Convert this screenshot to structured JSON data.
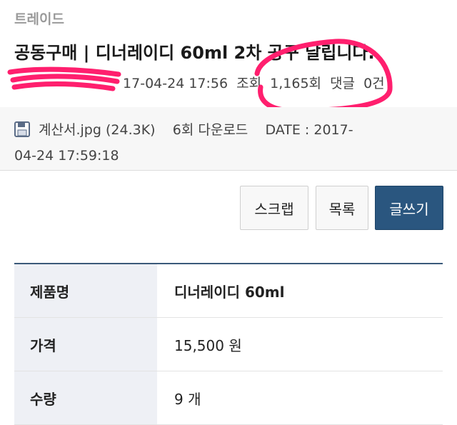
{
  "post": {
    "category": "트레이드",
    "title": "공동구매 | 디너레이디 60ml 2차 공구 날립니다.",
    "date": "17-04-24 17:56",
    "views_label": "조회",
    "views_value": "1,165회",
    "comments_label": "댓글",
    "comments_value": "0건"
  },
  "attachment": {
    "icon": "floppy-disk-icon",
    "filename": "계산서.jpg",
    "size": "(24.3K)",
    "downloads": "6회 다운로드",
    "date_label": "DATE : 2017-",
    "date_rest": "04-24 17:59:18"
  },
  "buttons": {
    "scrap": "스크랩",
    "list": "목록",
    "write": "글쓰기"
  },
  "colors": {
    "primary_button": "#2a567f",
    "annotation_scribble": "#ff1f6e"
  },
  "product_table": {
    "rows": [
      {
        "label": "제품명",
        "value": "디너레이디 60ml"
      },
      {
        "label": "가격",
        "value": "15,500 원"
      },
      {
        "label": "수량",
        "value": "9 개"
      }
    ]
  }
}
